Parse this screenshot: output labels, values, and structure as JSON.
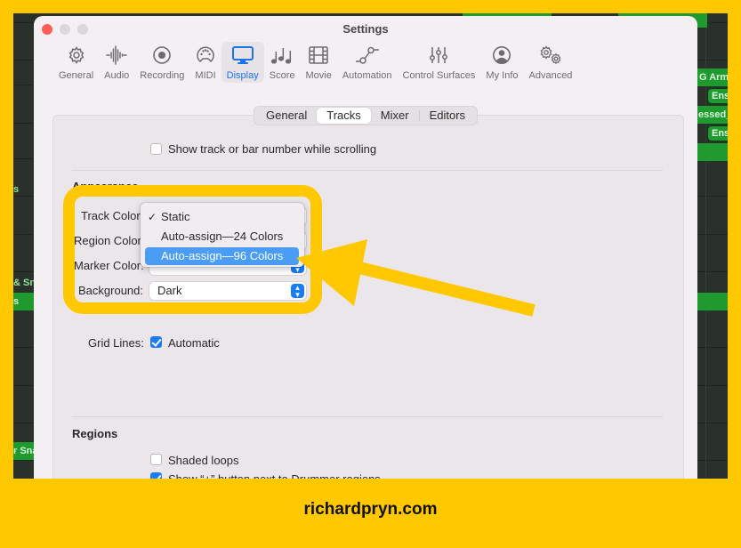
{
  "background_app": {
    "left_labels": [
      "s",
      "& Sn",
      "s",
      "r Sna"
    ],
    "right_labels": [
      "G Arm",
      "Ens",
      "essed_",
      "Ens"
    ]
  },
  "window": {
    "title": "Settings",
    "toolbar": [
      {
        "label": "General",
        "icon": "gear-icon"
      },
      {
        "label": "Audio",
        "icon": "waveform-icon"
      },
      {
        "label": "Recording",
        "icon": "record-icon"
      },
      {
        "label": "MIDI",
        "icon": "midi-port-icon"
      },
      {
        "label": "Display",
        "icon": "display-icon",
        "active": true
      },
      {
        "label": "Score",
        "icon": "music-notes-icon"
      },
      {
        "label": "Movie",
        "icon": "film-icon"
      },
      {
        "label": "Automation",
        "icon": "automation-icon"
      },
      {
        "label": "Control Surfaces",
        "icon": "sliders-icon"
      },
      {
        "label": "My Info",
        "icon": "person-icon"
      },
      {
        "label": "Advanced",
        "icon": "gears-icon"
      }
    ],
    "subtabs": [
      {
        "label": "General"
      },
      {
        "label": "Tracks",
        "active": true
      },
      {
        "label": "Mixer"
      },
      {
        "label": "Editors"
      }
    ],
    "show_track_number": {
      "label": "Show track or bar number while scrolling",
      "checked": false
    },
    "appearance": {
      "header": "Appearance",
      "track_color_label": "Track Color:",
      "region_color_label": "Region Color:",
      "marker_color_label": "Marker Color:",
      "background_label": "Background:",
      "background_value": "Dark",
      "menu_options": [
        {
          "label": "Static",
          "checked": true
        },
        {
          "label": "Auto-assign—24 Colors",
          "checked": false
        },
        {
          "label": "Auto-assign—96 Colors",
          "checked": false,
          "highlighted": true
        }
      ]
    },
    "grid_lines": {
      "label": "Grid Lines:",
      "option": "Automatic",
      "checked": true
    },
    "regions": {
      "header": "Regions",
      "shaded_loops": {
        "label": "Shaded loops",
        "checked": false
      },
      "drummer_plus": {
        "label": "Show “+” button next to Drummer regions",
        "checked": true
      }
    }
  },
  "annotation": {
    "highlight_color": "#ffc800",
    "footer": "richardpryn.com"
  }
}
